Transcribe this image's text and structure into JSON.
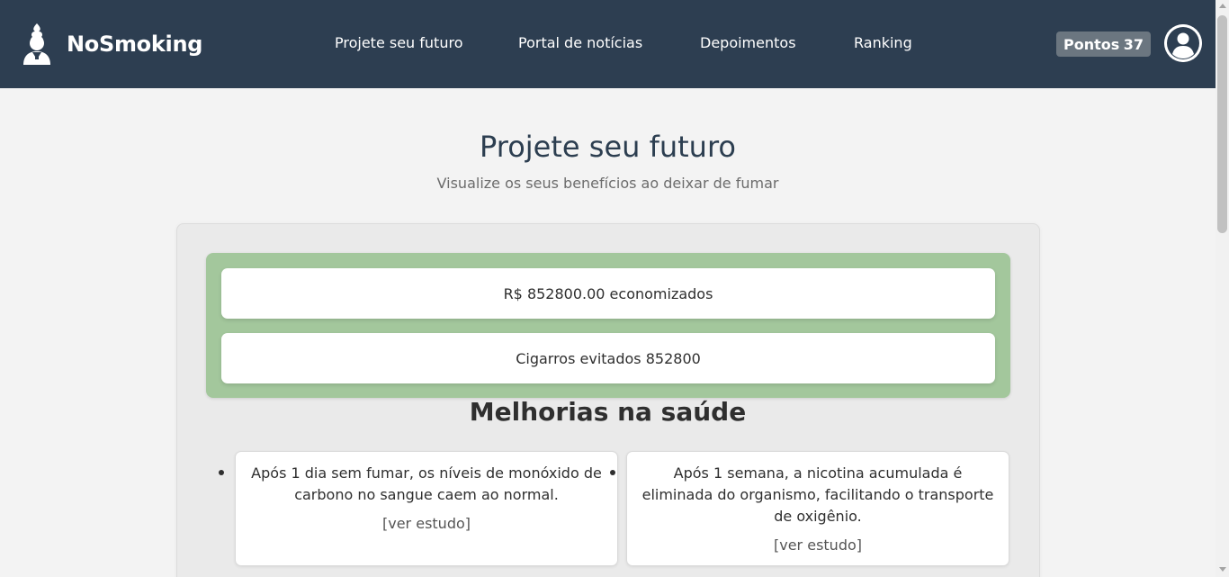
{
  "header": {
    "brand": "NoSmoking",
    "nav": [
      "Projete seu futuro",
      "Portal de notícias",
      "Depoimentos",
      "Ranking"
    ],
    "points_label": "Pontos",
    "points_value": "37"
  },
  "main": {
    "title": "Projete seu futuro",
    "subtitle": "Visualize os seus benefícios ao deixar de fumar",
    "money_saved": "R$ 852800.00 economizados",
    "cigarettes_avoided": "Cigarros evitados 852800",
    "health_title": "Melhorias na saúde",
    "health_items": [
      {
        "text": "Após 1 dia sem fumar, os níveis de monóxido de carbono no sangue caem ao normal.",
        "link": "[ver estudo]"
      },
      {
        "text": "Após 1 semana, a nicotina acumulada é eliminada do organismo, facilitando o transporte de oxigênio.",
        "link": "[ver estudo]"
      }
    ]
  },
  "colors": {
    "navbar": "#2d3e51",
    "savings_panel": "#a3c79c",
    "points_badge": "#6b7680"
  },
  "icons": [
    "brand-logo-icon",
    "user-avatar-icon"
  ]
}
